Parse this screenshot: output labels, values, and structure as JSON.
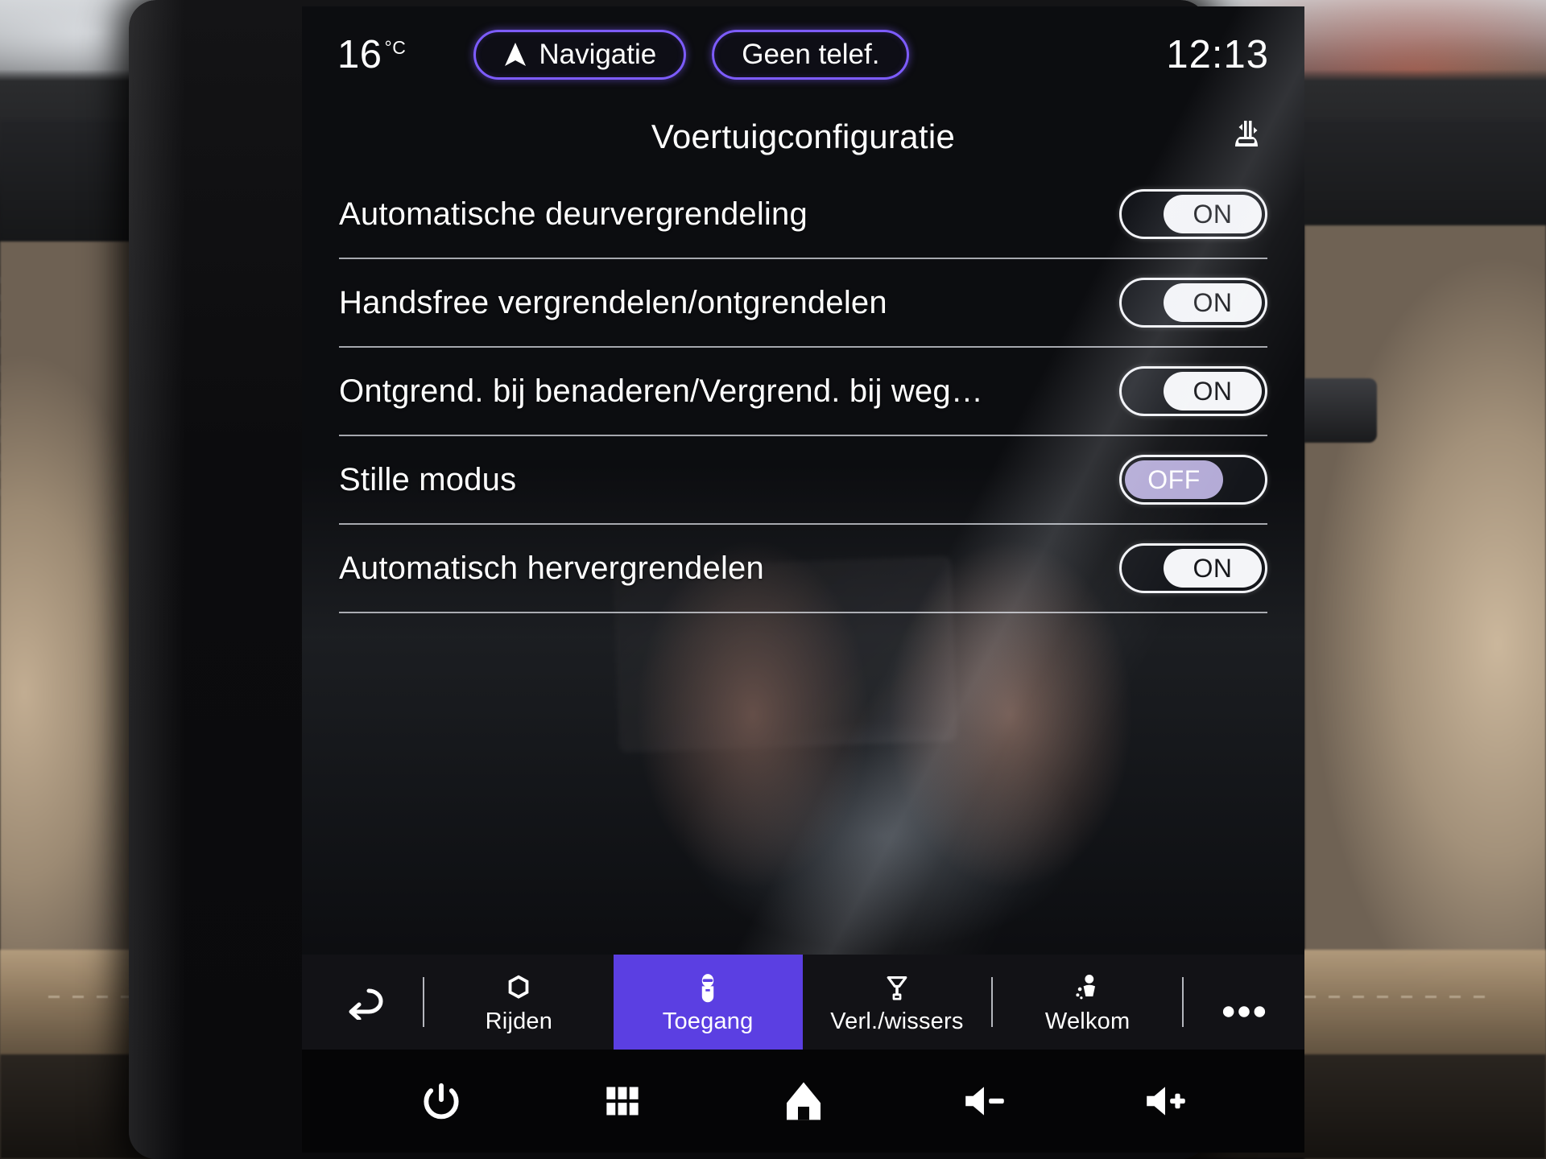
{
  "statusbar": {
    "temperature": "16",
    "temperature_unit": "°C",
    "nav_pill_label": "Navigatie",
    "nav_pill_icon": "navigation-arrow-icon",
    "phone_pill_label": "Geen telef.",
    "clock": "12:13",
    "accent_color": "#7d5cff"
  },
  "header": {
    "title": "Voertuigconfiguratie",
    "icon": "car-access-icon"
  },
  "settings": {
    "rows": [
      {
        "label": "Automatische deurvergrendeling",
        "state": "ON",
        "toggle_state_class": "on"
      },
      {
        "label": "Handsfree vergrendelen/ontgrendelen",
        "state": "ON",
        "toggle_state_class": "on"
      },
      {
        "label": "Ontgrend. bij benaderen/Vergrend. bij weg…",
        "state": "ON",
        "toggle_state_class": "on"
      },
      {
        "label": "Stille modus",
        "state": "OFF",
        "toggle_state_class": "off"
      },
      {
        "label": "Automatisch hervergrendelen",
        "state": "ON",
        "toggle_state_class": "on"
      }
    ]
  },
  "tabbar": {
    "back_icon": "back-arrow-icon",
    "more_icon": "more-options-icon",
    "active_color": "#5b3fe2",
    "tabs": [
      {
        "label": "Rijden",
        "icon": "wheel-icon",
        "active": false
      },
      {
        "label": "Toegang",
        "icon": "key-icon",
        "active": true
      },
      {
        "label": "Verl./wissers",
        "icon": "wiper-icon",
        "active": false
      },
      {
        "label": "Welkom",
        "icon": "welcome-icon",
        "active": false
      }
    ]
  },
  "sysbar": {
    "buttons": [
      {
        "icon": "power-icon"
      },
      {
        "icon": "apps-grid-icon"
      },
      {
        "icon": "home-icon"
      },
      {
        "icon": "volume-down-icon"
      },
      {
        "icon": "volume-up-icon"
      }
    ]
  }
}
